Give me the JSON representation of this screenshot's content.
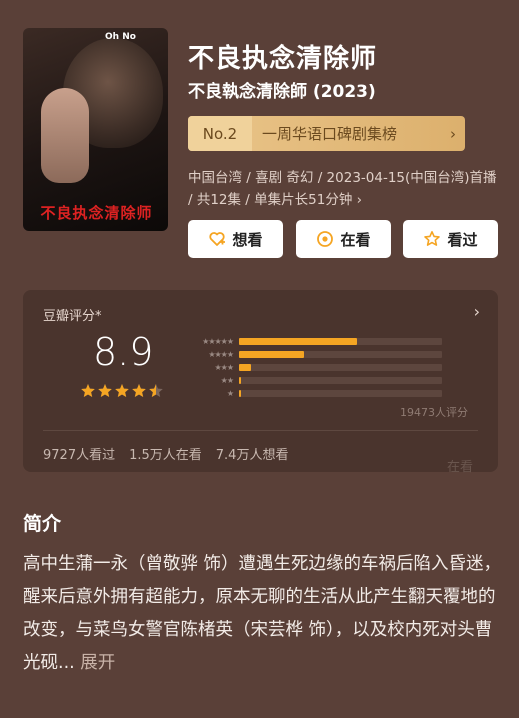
{
  "poster": {
    "badge_text": "Oh No",
    "title_art": "不良执念清除师"
  },
  "title": "不良执念清除师",
  "original_title": "不良執念清除師 (2023)",
  "rank": {
    "no": "No.2",
    "label": "一周华语口碑剧集榜",
    "chevron": "›"
  },
  "meta": {
    "text": "中国台湾 / 喜剧 奇幻 / 2023-04-15(中国台湾)首播 / 共12集 / 单集片长51分钟",
    "chevron": "›"
  },
  "actions": [
    {
      "label": "想看",
      "icon": "heart-plus-icon"
    },
    {
      "label": "在看",
      "icon": "circle-dot-icon"
    },
    {
      "label": "看过",
      "icon": "star-outline-icon"
    }
  ],
  "rating": {
    "label": "豆瓣评分*",
    "score": "8.9",
    "stars": 4.5,
    "distribution": [
      0.58,
      0.32,
      0.06,
      0.01,
      0.005
    ],
    "count": "19473人评分",
    "stats": [
      "9727人看过",
      "1.5万人在看",
      "7.4万人想看"
    ],
    "watermark": "在看",
    "chevron": "›",
    "accent": "#f5a523"
  },
  "intro": {
    "heading": "简介",
    "text": "高中生蒲一永（曾敬骅 饰）遭遇生死边缘的车祸后陷入昏迷，醒来后意外拥有超能力，原本无聊的生活从此产生翻天覆地的改变，与菜鸟女警官陈楮英（宋芸桦 饰），以及校内死对头曹光砚...",
    "more": "展开"
  }
}
